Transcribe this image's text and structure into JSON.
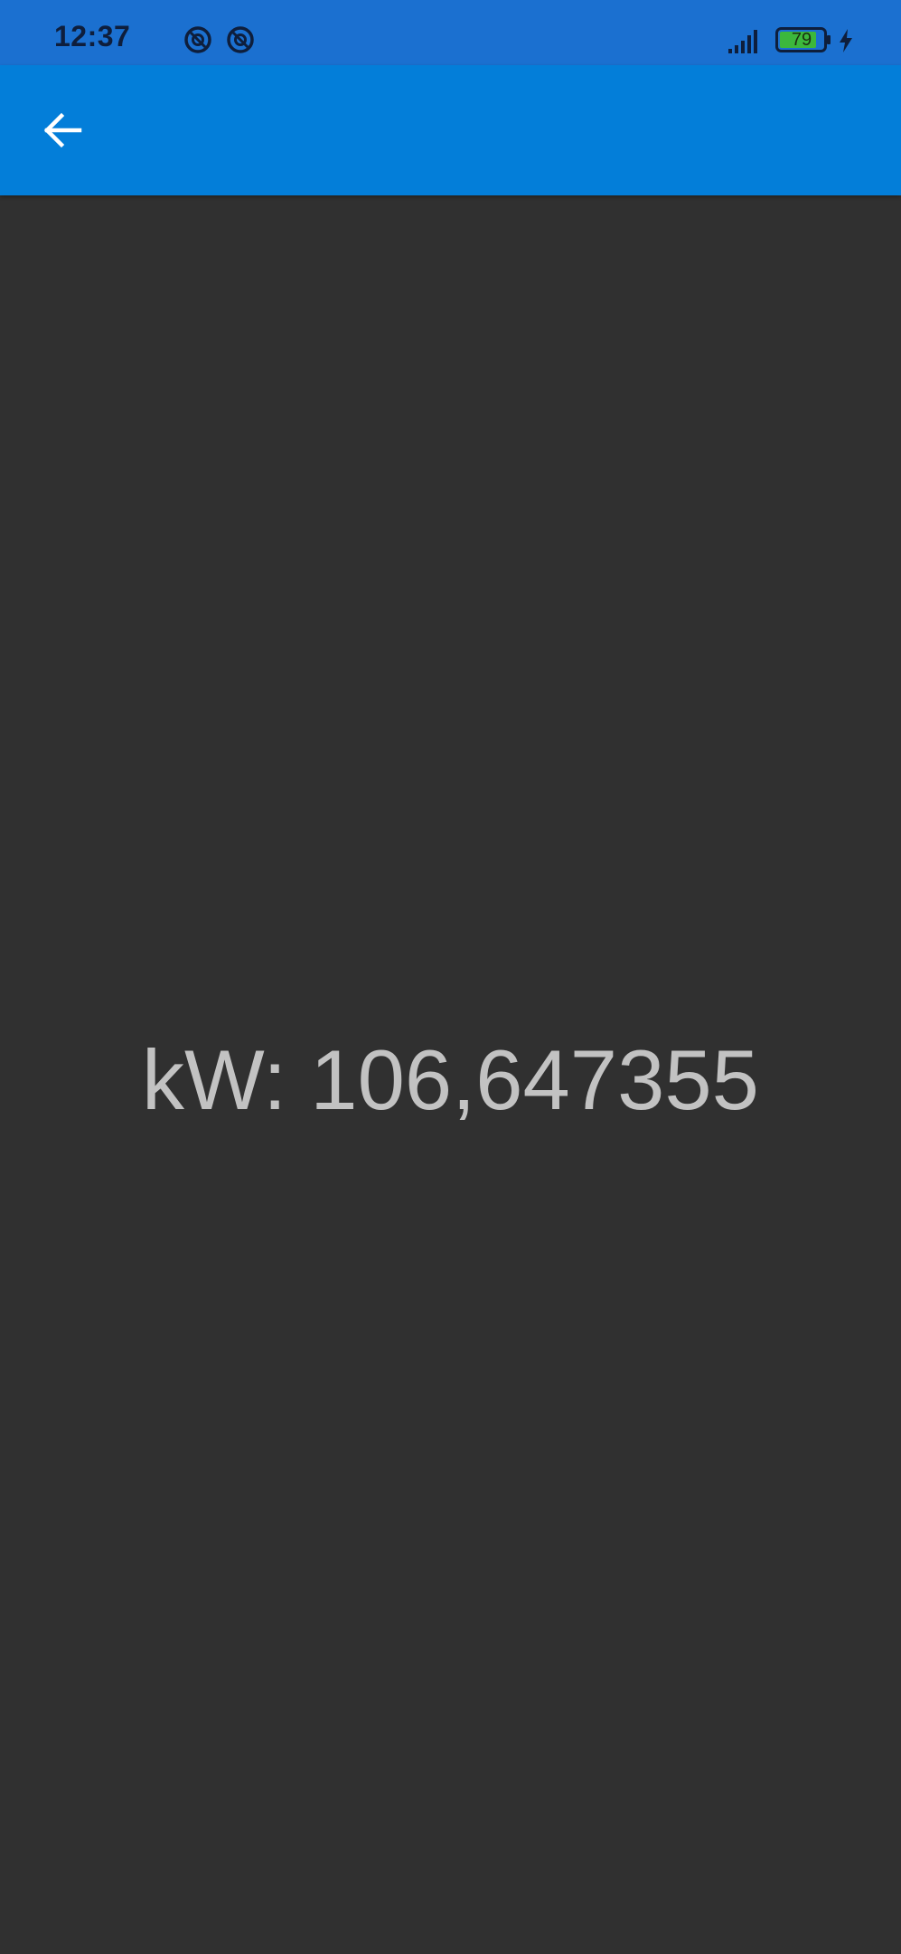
{
  "status_bar": {
    "time": "12:37",
    "notification_icons": [
      "no-disturb-icon",
      "no-disturb-icon"
    ],
    "signal_icon": "signal-icon",
    "battery_level": "79",
    "charging_icon": "charging-icon",
    "background_color": "#1b70d0"
  },
  "app_bar": {
    "back_icon": "arrow-back-icon",
    "background_color": "#037ed9"
  },
  "main": {
    "reading": "kW: 106,647355",
    "background_color": "#303030",
    "text_color": "#c2c2c2"
  }
}
